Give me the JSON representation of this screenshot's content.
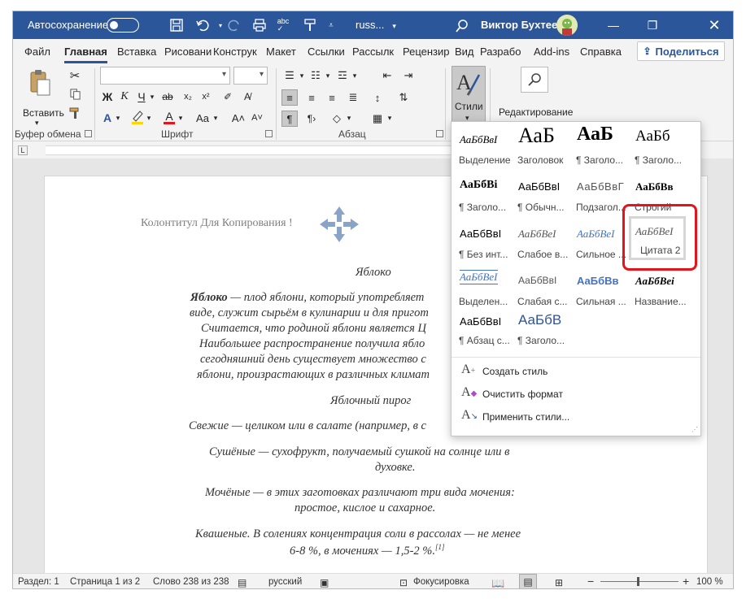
{
  "colors": {
    "brand": "#2b579a",
    "highlight": "#e3141c",
    "accent_red": "#e3141c",
    "accent_yellow": "#ffd700"
  },
  "titlebar": {
    "autosave_label": "Автосохранение",
    "doc_title": "russ...",
    "user_name": "Виктор Бухтеев",
    "icons": [
      "save-icon",
      "undo-icon",
      "redo-icon",
      "print-preview-icon",
      "spelling-icon",
      "format-painter-icon",
      "more-icon",
      "search-icon",
      "minimize-icon",
      "restore-icon",
      "close-icon"
    ]
  },
  "tabs": [
    "Файл",
    "Главная",
    "Вставка",
    "Рисовани",
    "Конструк",
    "Макет",
    "Ссылки",
    "Рассылк",
    "Рецензир",
    "Вид",
    "Разрабо",
    "Add-ins",
    "Справка"
  ],
  "share_label": "Поделиться",
  "ribbon": {
    "paste_label": "Вставить",
    "clipboard_label": "Буфер обмена",
    "font_label": "Шрифт",
    "paragraph_label": "Абзац",
    "styles_button_label": "Стили",
    "styles_group_short": "С",
    "editing_label": "Редактирование",
    "font_name_value": "",
    "font_size_value": ""
  },
  "document": {
    "header": "Колонтитул Для Копирования !",
    "lines": [
      "Яблоко",
      "— плод яблони, который употребляет",
      "виде, служит сырьём в кулинарии и для пригот",
      "Считается, что родиной яблони является Ц",
      "Наибольшее распространение получила ябло",
      "сегодняшний день существует множество с",
      "яблони, произрастающих в различных климат",
      "Яблочный пирог",
      "Свежие — целиком или в салате (например, в с",
      "Сушёные — сухофрукт, получаемый сушкой на солнце или в",
      "духовке.",
      "Мочёные — в этих заготовках различают три вида мочения:",
      "простое, кислое и сахарное.",
      "Квашеные. В солениях концентрация соли в рассолах — не менее",
      "6-8 %, в мочениях — 1,5-2 %.",
      "[1]"
    ],
    "bold_word": "Яблоко"
  },
  "styles_gallery": {
    "items": [
      {
        "preview": "АаБбВвI",
        "name": "Выделение"
      },
      {
        "preview": "АаБ",
        "name": "Заголовок"
      },
      {
        "preview": "АаБ",
        "name": "¶ Заголо..."
      },
      {
        "preview": "АаБб",
        "name": "¶ Заголо..."
      },
      {
        "preview": "АаБбВі",
        "name": "¶ Заголо..."
      },
      {
        "preview": "АаБбВвІ",
        "name": "¶ Обычн..."
      },
      {
        "preview": "АаБбВвГ",
        "name": "Подзагол..."
      },
      {
        "preview": "АаБбВв",
        "name": "Строгий"
      },
      {
        "preview": "АаБбВвІ",
        "name": "¶ Без инт..."
      },
      {
        "preview": "АаБбВеІ",
        "name": "Слабое в..."
      },
      {
        "preview": "АаБбВеІ",
        "name": "Сильное ..."
      },
      {
        "preview": "АаБбВеІ",
        "name": "Цитата 2"
      },
      {
        "preview": "АаБбВеІ",
        "name": "Выделен..."
      },
      {
        "preview": "АаБбВвІ",
        "name": "Слабая с..."
      },
      {
        "preview": "АаБбВв",
        "name": "Сильная ..."
      },
      {
        "preview": "АаБбВеі",
        "name": "Название..."
      },
      {
        "preview": "АаБбВвІ",
        "name": "¶ Абзац с..."
      },
      {
        "preview": "АаБбВ",
        "name": "¶ Заголо..."
      }
    ],
    "create_style": "Создать стиль",
    "clear_format": "Очистить формат",
    "apply_styles": "Применить стили..."
  },
  "statusbar": {
    "section": "Раздел: 1",
    "page": "Страница 1 из 2",
    "words": "Слово 238 из 238",
    "language": "русский",
    "focus": "Фокусировка",
    "zoom_minus": "−",
    "zoom_plus": "+",
    "zoom": "100 %"
  }
}
